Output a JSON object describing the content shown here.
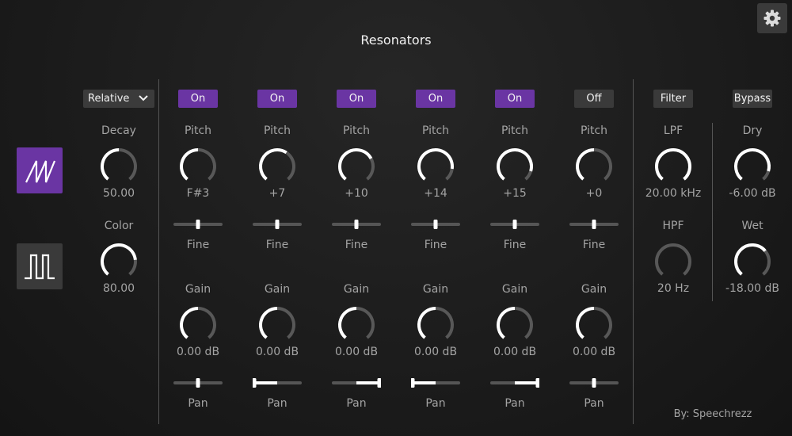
{
  "title": "Resonators",
  "settings_icon": "gear-icon",
  "mode": {
    "selected": "Relative"
  },
  "waveforms": [
    {
      "name": "saw-wave-icon",
      "active": true
    },
    {
      "name": "square-wave-icon",
      "active": false
    }
  ],
  "global": {
    "decay": {
      "label": "Decay",
      "value": "50.00",
      "level": 0.5
    },
    "color": {
      "label": "Color",
      "value": "80.00",
      "level": 0.8
    }
  },
  "resonators": [
    {
      "toggle": "On",
      "pitch_label": "Pitch",
      "pitch": "F#3",
      "pitch_level": 0.5,
      "fine_label": "Fine",
      "fine": 0.5,
      "gain_label": "Gain",
      "gain": "0.00 dB",
      "gain_level": 0.5,
      "pan_label": "Pan",
      "pan": 0.5
    },
    {
      "toggle": "On",
      "pitch_label": "Pitch",
      "pitch": "+7",
      "pitch_level": 0.62,
      "fine_label": "Fine",
      "fine": 0.5,
      "gain_label": "Gain",
      "gain": "0.00 dB",
      "gain_level": 0.5,
      "pan_label": "Pan",
      "pan": 0.0
    },
    {
      "toggle": "On",
      "pitch_label": "Pitch",
      "pitch": "+10",
      "pitch_level": 0.72,
      "fine_label": "Fine",
      "fine": 0.5,
      "gain_label": "Gain",
      "gain": "0.00 dB",
      "gain_level": 0.5,
      "pan_label": "Pan",
      "pan": 1.0
    },
    {
      "toggle": "On",
      "pitch_label": "Pitch",
      "pitch": "+14",
      "pitch_level": 0.85,
      "fine_label": "Fine",
      "fine": 0.5,
      "gain_label": "Gain",
      "gain": "0.00 dB",
      "gain_level": 0.5,
      "pan_label": "Pan",
      "pan": 0.0
    },
    {
      "toggle": "On",
      "pitch_label": "Pitch",
      "pitch": "+15",
      "pitch_level": 0.88,
      "fine_label": "Fine",
      "fine": 0.5,
      "gain_label": "Gain",
      "gain": "0.00 dB",
      "gain_level": 0.5,
      "pan_label": "Pan",
      "pan": 1.0
    },
    {
      "toggle": "Off",
      "pitch_label": "Pitch",
      "pitch": "+0",
      "pitch_level": 0.5,
      "fine_label": "Fine",
      "fine": 0.5,
      "gain_label": "Gain",
      "gain": "0.00 dB",
      "gain_level": 0.5,
      "pan_label": "Pan",
      "pan": 0.5
    }
  ],
  "filter": {
    "button": "Filter",
    "lpf": {
      "label": "LPF",
      "value": "20.00 kHz",
      "level": 1.0
    },
    "hpf": {
      "label": "HPF",
      "value": "20 Hz",
      "level": 0.0
    }
  },
  "mix": {
    "button": "Bypass",
    "dry": {
      "label": "Dry",
      "value": "-6.00 dB",
      "level": 0.88
    },
    "wet": {
      "label": "Wet",
      "value": "-18.00 dB",
      "level": 0.68
    }
  },
  "credit": "By: Speechrezz",
  "colors": {
    "accent": "#6a35a3",
    "knob_value": "#ffffff",
    "knob_track": "#585858",
    "slider_track": "#555555",
    "off_button": "#3a3a3a"
  }
}
